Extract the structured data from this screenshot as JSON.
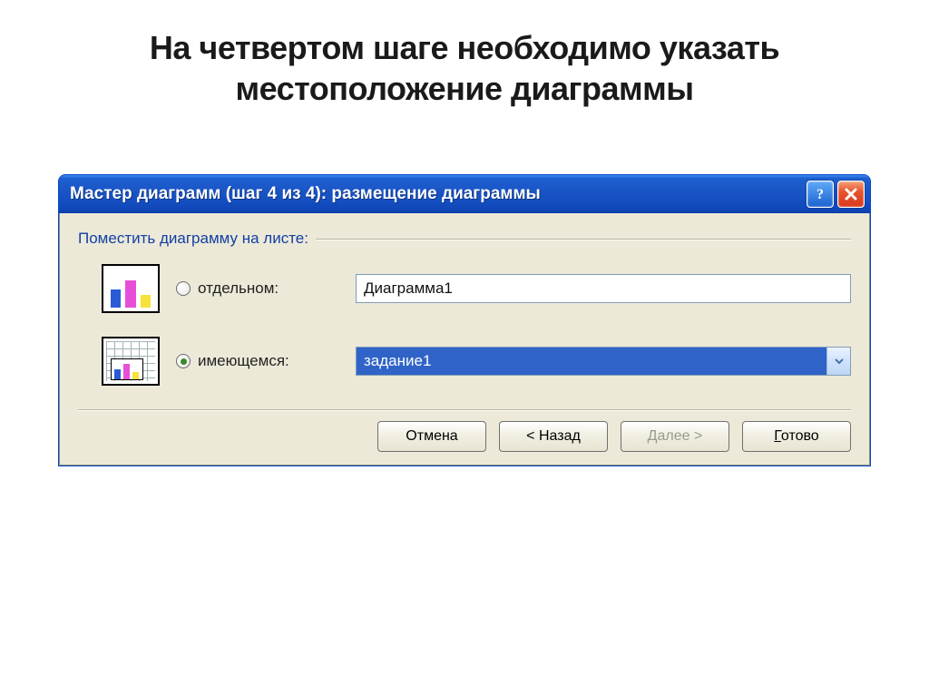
{
  "slide": {
    "title": "На четвертом шаге необходимо указать местоположение диаграммы"
  },
  "window": {
    "title": "Мастер диаграмм (шаг 4 из 4): размещение диаграммы"
  },
  "group": {
    "label": "Поместить диаграмму на листе:"
  },
  "options": {
    "new_sheet": {
      "label": "отдельном:",
      "selected": false,
      "value": "Диаграмма1"
    },
    "existing_sheet": {
      "label": "имеющемся:",
      "selected": true,
      "value": "задание1"
    }
  },
  "buttons": {
    "cancel": "Отмена",
    "back": "< Назад",
    "next": "Далее >",
    "finish_prefix": "Г",
    "finish_rest": "отово"
  },
  "icons": {
    "help": "help-icon",
    "close": "close-icon",
    "chart_new": "chart-new-sheet-icon",
    "chart_existing": "chart-existing-sheet-icon",
    "dropdown": "chevron-down-icon"
  }
}
